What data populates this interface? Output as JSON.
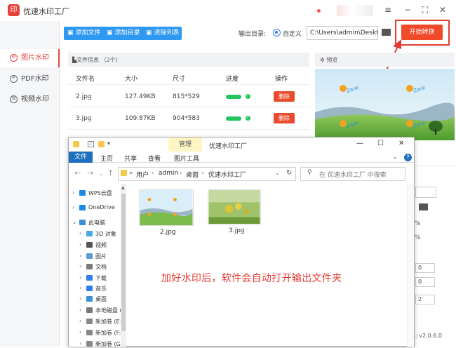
{
  "app": {
    "logo_text": "印",
    "title": "优速水印工厂",
    "window_controls": [
      "≡",
      "−",
      "⛶",
      "✕"
    ]
  },
  "sidebar": {
    "items": [
      {
        "icon": "印",
        "label": "图片水印",
        "active": true
      },
      {
        "icon": "P",
        "label": "PDF水印",
        "active": false
      },
      {
        "icon": "视",
        "label": "视频水印",
        "active": false
      }
    ]
  },
  "toolbar": {
    "add_file": "添加文件",
    "add_dir": "添加目录",
    "clear": "清除列表",
    "output_label": "输出目录:",
    "radio_label": "自定义",
    "path_value": "C:\\Users\\admin\\Deskto",
    "start": "开始转换"
  },
  "file_panel": {
    "header": "文件信息 （2个）",
    "columns": [
      "文件名",
      "大小",
      "尺寸",
      "进度",
      "操作"
    ],
    "rows": [
      {
        "name": "2.jpg",
        "size": "127.49KB",
        "dims": "815*529",
        "action": "删除"
      },
      {
        "name": "3.jpg",
        "size": "109.87KB",
        "dims": "904*583",
        "action": "删除"
      }
    ]
  },
  "preview": {
    "title": "预览",
    "watermark_text": "Zank"
  },
  "settings_peek": {
    "pct1": "%",
    "pct2": "%",
    "spin1": "0",
    "spin2": "0",
    "spin3": "2",
    "version": "本: v2.0.6.0"
  },
  "explorer": {
    "manage": "管理",
    "caption": "优速水印工厂",
    "controls": [
      "—",
      "☐",
      "✕"
    ],
    "ribbon": {
      "file": "文件",
      "tabs": [
        "主页",
        "共享",
        "查看",
        "图片工具"
      ]
    },
    "address": {
      "prefix": "«",
      "crumbs": [
        "用户",
        "admin",
        "桌面",
        "优速水印工厂"
      ]
    },
    "search_placeholder": "在 优速水印工厂 中搜索",
    "tree": [
      {
        "label": "WPS云盘",
        "color": "#1e88e5",
        "arrow": "›"
      },
      {
        "label": "OneDrive",
        "color": "#1e88e5",
        "arrow": "›"
      },
      {
        "label": "此电脑",
        "color": "#3d8fd6",
        "arrow": "⌄"
      },
      {
        "label": "3D 对象",
        "color": "#4aa8e0",
        "arrow": "›"
      },
      {
        "label": "视频",
        "color": "#555555",
        "arrow": "›"
      },
      {
        "label": "图片",
        "color": "#5a9bd5",
        "arrow": "›"
      },
      {
        "label": "文档",
        "color": "#7a7a7a",
        "arrow": "›"
      },
      {
        "label": "下载",
        "color": "#2f80ed",
        "arrow": "›"
      },
      {
        "label": "音乐",
        "color": "#2f80ed",
        "arrow": "›"
      },
      {
        "label": "桌面",
        "color": "#3d8fd6",
        "arrow": "›"
      },
      {
        "label": "本地磁盘 (",
        "color": "#777777",
        "arrow": "›"
      },
      {
        "label": "新加卷 (E:)",
        "color": "#888888",
        "arrow": "›"
      },
      {
        "label": "新加卷 (F:)",
        "color": "#888888",
        "arrow": "›"
      },
      {
        "label": "新加卷 (G:",
        "color": "#888888",
        "arrow": "›"
      }
    ],
    "files": [
      {
        "name": "2.jpg"
      },
      {
        "name": "3.jpg"
      }
    ],
    "notice": "加好水印后，软件会自动打开输出文件夹"
  },
  "colors": {
    "accent_red": "#e33b32",
    "toolbar_blue": "#2f98f0",
    "progress_green": "#22c55e"
  }
}
